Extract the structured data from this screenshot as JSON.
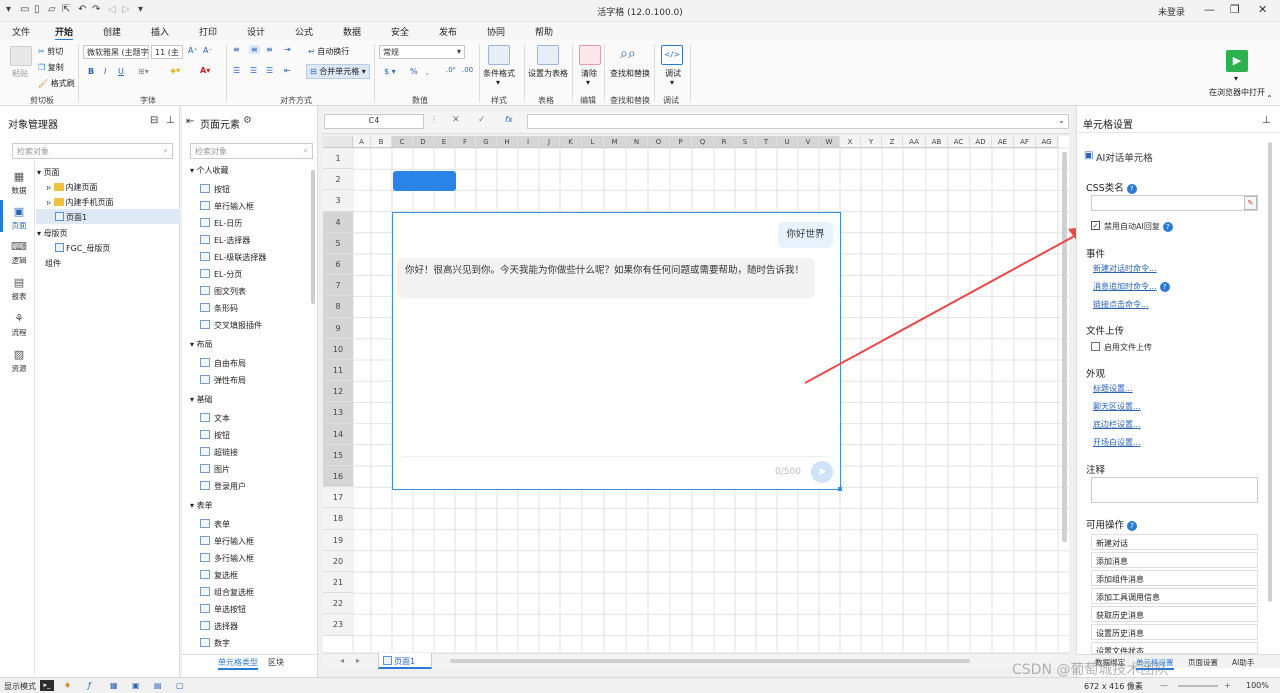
{
  "title_bar": {
    "app_title": "活字格 (12.0.100.0)",
    "login": "未登录"
  },
  "menu": [
    "文件",
    "开始",
    "创建",
    "插入",
    "打印",
    "设计",
    "公式",
    "数据",
    "安全",
    "发布",
    "协同",
    "帮助"
  ],
  "ribbon": {
    "clipboard": {
      "paste": "粘贴",
      "cut": "剪切",
      "copy": "复制",
      "format_painter": "格式刷",
      "group": "剪切板"
    },
    "font": {
      "name": "微软雅黑 (主题字",
      "size": "11 (主",
      "group": "字体"
    },
    "align": {
      "wrap": "自动换行",
      "merge": "合并单元格",
      "group": "对齐方式"
    },
    "number": {
      "format": "常规",
      "group": "数值"
    },
    "style": {
      "cond": "条件格式",
      "group": "样式"
    },
    "table": {
      "set": "设置为表格",
      "group": "表格"
    },
    "edit": {
      "clear": "清除",
      "group": "编辑"
    },
    "find": {
      "label": "查找和替换",
      "group": "查找和替换"
    },
    "debug": {
      "label": "调试",
      "group": "调试"
    },
    "browser": "在浏览器中打开"
  },
  "object_manager": {
    "title": "对象管理器",
    "search_placeholder": "检索对象",
    "nav": [
      "数据",
      "页面",
      "逻辑",
      "报表",
      "流程",
      "资源"
    ],
    "tree": [
      "页面",
      "内建页面",
      "内建手机页面",
      "页面1",
      "母版页",
      "FGC_母版页",
      "组件"
    ]
  },
  "elements": {
    "title": "页面元素",
    "search_placeholder": "检索对象",
    "sections": [
      {
        "name": "个人收藏",
        "items": [
          "按钮",
          "单行输入框",
          "EL-日历",
          "EL-选择器",
          "EL-级联选择器",
          "EL-分页",
          "图文列表",
          "条形码",
          "交叉填报插件"
        ]
      },
      {
        "name": "布局",
        "items": [
          "自由布局",
          "弹性布局"
        ]
      },
      {
        "name": "基础",
        "items": [
          "文本",
          "按钮",
          "超链接",
          "图片",
          "登录用户"
        ]
      },
      {
        "name": "表单",
        "items": [
          "表单",
          "单行输入框",
          "多行输入框",
          "复选框",
          "组合复选框",
          "单选按钮",
          "选择器",
          "数字"
        ]
      }
    ],
    "tabs": [
      "单元格类型",
      "区块"
    ]
  },
  "formula_bar": {
    "cell": "C4",
    "fx": "fx"
  },
  "columns": [
    "A",
    "B",
    "C",
    "D",
    "E",
    "F",
    "G",
    "H",
    "I",
    "J",
    "K",
    "L",
    "M",
    "N",
    "O",
    "P",
    "Q",
    "R",
    "S",
    "T",
    "U",
    "V",
    "W",
    "X",
    "Y",
    "Z",
    "AA",
    "AB",
    "AC",
    "AD",
    "AE",
    "AF",
    "AG"
  ],
  "rows": [
    "1",
    "2",
    "3",
    "4",
    "5",
    "6",
    "7",
    "8",
    "9",
    "10",
    "11",
    "12",
    "13",
    "14",
    "15",
    "16",
    "17",
    "18",
    "19",
    "20",
    "21",
    "22",
    "23"
  ],
  "chat": {
    "user_msg": "你好世界",
    "ai_msg": "你好！很高兴见到你。今天我能为你做些什么呢？如果你有任何问题或需要帮助，随时告诉我！",
    "counter": "0/500"
  },
  "sheet_tab": "页面1",
  "cell_settings": {
    "title": "单元格设置",
    "type": "AI对话单元格",
    "css_label": "CSS类名",
    "disable_ai": "禁用自动AI回复",
    "events_label": "事件",
    "events": [
      "新建对话时命令...",
      "消息追加时命令...",
      "链接点击命令..."
    ],
    "upload_label": "文件上传",
    "upload_enable": "启用文件上传",
    "appearance_label": "外观",
    "appearance": [
      "标题设置...",
      "聊天区设置...",
      "底边栏设置...",
      "开场白设置..."
    ],
    "note_label": "注释",
    "ops_label": "可用操作",
    "ops": [
      "新建对话",
      "添加消息",
      "添加组件消息",
      "添加工具调用信息",
      "获取历史消息",
      "设置历史消息",
      "设置文件状态"
    ],
    "bottom_tabs": [
      "数据绑定",
      "单元格设置",
      "页面设置",
      "AI助手"
    ]
  },
  "status": {
    "mode": "显示模式",
    "size": "672 x 416 像素",
    "zoom": "100%",
    "watermark": "CSDN @葡萄城技术团队"
  },
  "colors": {
    "accent": "#2a7ad6",
    "arrow": "#e84848",
    "run": "#2bb24c"
  }
}
